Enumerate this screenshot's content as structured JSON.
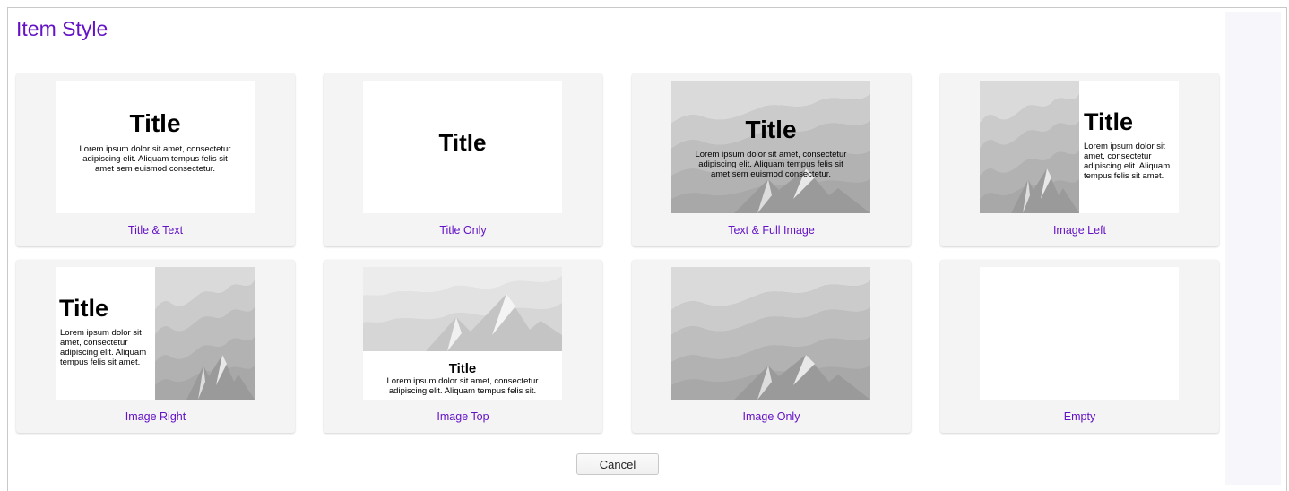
{
  "dialog": {
    "heading": "Item Style",
    "cancel_label": "Cancel"
  },
  "sample": {
    "title": "Title",
    "text_long": "Lorem ipsum dolor sit amet, consectetur adipiscing elit. Aliquam tempus felis sit amet sem euismod consectetur.",
    "text_side": "Lorem ipsum dolor sit amet, consectetur adipiscing elit. Aliquam tempus felis sit amet.",
    "text_short": "Lorem ipsum dolor sit amet, consectetur adipiscing elit. Aliquam tempus felis sit."
  },
  "styles": [
    {
      "label": "Title & Text"
    },
    {
      "label": "Title Only"
    },
    {
      "label": "Text & Full Image"
    },
    {
      "label": "Image Left"
    },
    {
      "label": "Image Right"
    },
    {
      "label": "Image Top"
    },
    {
      "label": "Image Only"
    },
    {
      "label": "Empty"
    }
  ],
  "colors": {
    "accent": "#6412c7",
    "card_background": "#f4f4f4",
    "image_gray": "#a9a9a9"
  }
}
